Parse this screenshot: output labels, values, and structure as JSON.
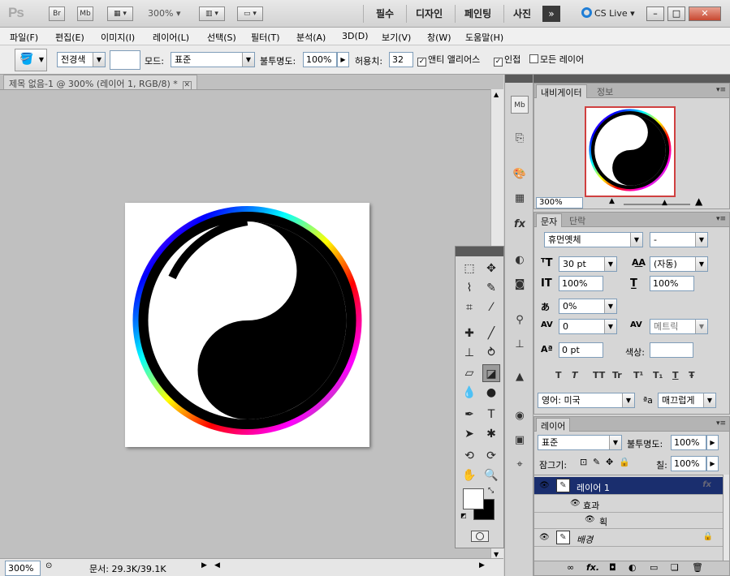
{
  "appbar": {
    "logo": "Ps",
    "bridge_label": "Br",
    "minibridge_label": "Mb",
    "zoom_label": "300%",
    "workspaces": [
      "필수",
      "디자인",
      "페인팅",
      "사진"
    ],
    "more_label": "»",
    "cslive_label": "CS Live",
    "window_buttons": [
      "–",
      "□",
      "✕"
    ]
  },
  "menubar": {
    "items": [
      "파일(F)",
      "편집(E)",
      "이미지(I)",
      "레이어(L)",
      "선택(S)",
      "필터(T)",
      "분석(A)",
      "3D(D)",
      "보기(V)",
      "창(W)",
      "도움말(H)"
    ]
  },
  "options": {
    "fill_source": "전경색",
    "mode_label": "모드:",
    "mode_value": "표준",
    "opacity_label": "불투명도:",
    "opacity_value": "100%",
    "tolerance_label": "허용치:",
    "tolerance_value": "32",
    "antialias_label": "앤티 앨리어스",
    "contiguous_label": "인접",
    "all_layers_label": "모든 레이어"
  },
  "document": {
    "tab_title": "제목 없음-1 @ 300% (레이어 1, RGB/8) *",
    "zoom": "300%",
    "doc_info": "문서: 29.3K/39.1K"
  },
  "navigator": {
    "tabs": [
      "내비게이터",
      "정보"
    ],
    "zoom": "300%"
  },
  "character": {
    "tabs": [
      "문자",
      "단락"
    ],
    "font_family": "휴먼옛체",
    "font_style": "-",
    "font_size": "30 pt",
    "leading": "(자동)",
    "vertical_scale": "100%",
    "horizontal_scale": "100%",
    "tsume": "0%",
    "kerning": "0",
    "tracking": "메트릭",
    "baseline_shift": "0 pt",
    "color_label": "색상:",
    "format_buttons": [
      "T",
      "T",
      "TT",
      "Tr",
      "T¹",
      "T₁",
      "T",
      "Ŧ"
    ],
    "language": "영어: 미국",
    "aa_label": "ªa",
    "antialias": "매끄럽게"
  },
  "layers": {
    "tab": "레이어",
    "blend_mode": "표준",
    "opacity_label": "불투명도:",
    "opacity_value": "100%",
    "lock_label": "잠그기:",
    "fill_label": "칠:",
    "fill_value": "100%",
    "rows": [
      {
        "name": "레이어 1"
      },
      {
        "name": "효과"
      },
      {
        "name": "획"
      },
      {
        "name": "배경"
      }
    ],
    "fx_label": "fx"
  },
  "colors": {
    "accent_selected": "#1a2e6e",
    "navigator_frame": "#d04040",
    "foreground": "#ffffff",
    "background": "#000000"
  }
}
